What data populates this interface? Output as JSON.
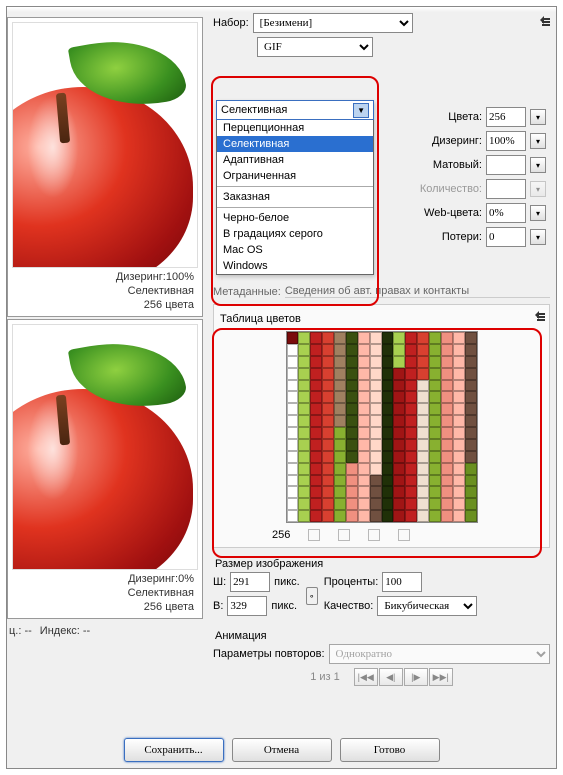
{
  "header": {
    "preset_label": "Набор:",
    "preset_value": "[Безимени]",
    "format_value": "GIF"
  },
  "algorithm_dropdown": {
    "selected": "Селективная",
    "options": [
      {
        "label": "Перцепционная"
      },
      {
        "label": "Селективная",
        "selected": true
      },
      {
        "label": "Адаптивная"
      },
      {
        "label": "Ограниченная"
      },
      {
        "sep": true
      },
      {
        "label": "Заказная"
      },
      {
        "sep": true
      },
      {
        "label": "Черно-белое"
      },
      {
        "label": "В градациях серого"
      },
      {
        "label": "Mac OS"
      },
      {
        "label": "Windows"
      }
    ]
  },
  "options": {
    "colors_label": "Цвета:",
    "colors_value": "256",
    "dither_label": "Дизеринг:",
    "dither_value": "100%",
    "matte_label": "Матовый:",
    "matte_value": "",
    "amount_label": "Количество:",
    "amount_value": "",
    "websnap_label": "Web-цвета:",
    "websnap_value": "0%",
    "lossy_label": "Потери:",
    "lossy_value": "0"
  },
  "metadata_row": {
    "label": "Метаданные:",
    "value": "Сведения об авт. правах и контакты"
  },
  "color_table": {
    "title": "Таблица цветов",
    "count": "256"
  },
  "preview1": {
    "dither": "Дизеринг:100%",
    "algo": "Селективная",
    "colors": "256 цвета"
  },
  "preview2": {
    "dither": "Дизеринг:0%",
    "algo": "Селективная",
    "colors": "256 цвета"
  },
  "status": {
    "col1": "ц.: --",
    "col2": "Индекс: --"
  },
  "size": {
    "title": "Размер изображения",
    "w_label": "Ш:",
    "w_value": "291",
    "h_label": "В:",
    "h_value": "329",
    "unit": "пикс.",
    "percent_label": "Проценты:",
    "percent_value": "100",
    "quality_label": "Качество:",
    "quality_value": "Бикубическая"
  },
  "anim": {
    "title": "Анимация",
    "repeat_label": "Параметры повторов:",
    "repeat_value": "Однократно",
    "pager": "1 из 1"
  },
  "buttons": {
    "save": "Сохранить...",
    "cancel": "Отмена",
    "done": "Готово"
  },
  "chart_data": {
    "type": "table",
    "description": "16x16 color palette swatch (256 colors) dominated by red and green hues",
    "count": 256
  }
}
